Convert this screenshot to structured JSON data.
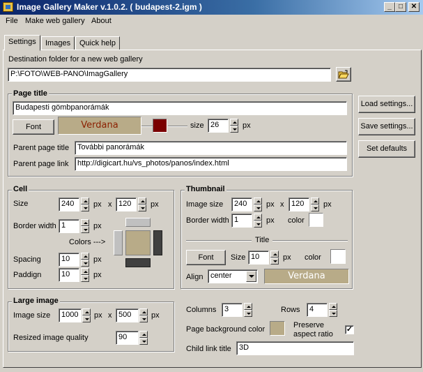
{
  "window": {
    "title": "Image Gallery Maker  v.1.0.2.  ( budapest-2.igm )",
    "minimize": "_",
    "maximize": "□",
    "close": "✕"
  },
  "menu": [
    "File",
    "Make web gallery",
    "About"
  ],
  "tabs": [
    "Settings",
    "Images",
    "Quick help"
  ],
  "destination": {
    "label": "Destination folder for a new web gallery",
    "value": "P:\\FOTO\\WEB-PANO\\ImagGallery"
  },
  "page_title": {
    "group_label": "Page title",
    "value": "Budapesti gömbpanorámák",
    "font_button": "Font",
    "font_preview": "Verdana",
    "color": "#7a0000",
    "size_label": "size",
    "size_value": "26",
    "size_unit": "px",
    "parent_title_label": "Parent page title",
    "parent_title_value": "További panorámák",
    "parent_link_label": "Parent page link",
    "parent_link_value": "http://digicart.hu/vs_photos/panos/index.html"
  },
  "side_buttons": {
    "load": "Load settings...",
    "save": "Save settings...",
    "defaults": "Set defaults"
  },
  "cell": {
    "group_label": "Cell",
    "size_label": "Size",
    "width": "240",
    "height": "120",
    "px": "px",
    "x": "x",
    "border_label": "Border width",
    "border": "1",
    "colors_label": "Colors --->",
    "spacing_label": "Spacing",
    "spacing": "10",
    "padding_label": "Paddign",
    "padding": "10"
  },
  "thumbnail": {
    "group_label": "Thumbnail",
    "image_size_label": "Image size",
    "width": "240",
    "height": "120",
    "px": "px",
    "x": "x",
    "border_label": "Border width",
    "border": "1",
    "color_label": "color",
    "border_color": "#ffffff",
    "title_label": "Title",
    "font_button": "Font",
    "title_size_label": "Size",
    "title_size": "10",
    "title_color_label": "color",
    "title_color": "#ffffff",
    "align_label": "Align",
    "align_value": "center",
    "font_preview": "Verdana"
  },
  "large_image": {
    "group_label": "Large image",
    "size_label": "Image size",
    "width": "1000",
    "height": "500",
    "px": "px",
    "x": "x",
    "quality_label": "Resized image quality",
    "quality": "90"
  },
  "layout": {
    "columns_label": "Columns",
    "columns": "3",
    "rows_label": "Rows",
    "rows": "4",
    "bg_color_label": "Page background color",
    "bg_color": "#b8ab88",
    "preserve_label_1": "Preserve",
    "preserve_label_2": "aspect ratio",
    "preserve_checked": "✓",
    "child_link_label": "Child link title",
    "child_link_value": "3D"
  }
}
